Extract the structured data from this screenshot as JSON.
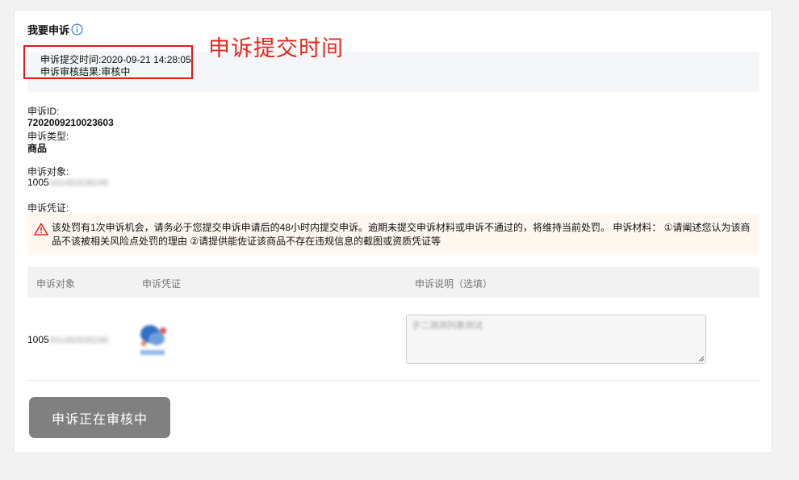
{
  "page": {
    "title": "我要申诉"
  },
  "annotation": {
    "label": "申诉提交时间"
  },
  "status": {
    "submit_time_label": "申诉提交时间:",
    "submit_time_value": "2020-09-21 14:28:05",
    "result_label": "申诉审核结果:",
    "result_value": "审核中"
  },
  "details": {
    "id_label": "申诉ID:",
    "id_value": "7202009210023603",
    "type_label": "申诉类型:",
    "type_value": "商品",
    "target_label": "申诉对象:",
    "target_value_prefix": "1005",
    "target_value_blurred": "001482638248",
    "evidence_label": "申诉凭证:"
  },
  "warning": {
    "text": "该处罚有1次申诉机会，请务必于您提交申诉申请后的48小时内提交申诉。逾期未提交申诉材料或申诉不通过的，将维持当前处罚。 申诉材料： ①请阐述您认为该商品不该被相关风险点处罚的理由 ②请提供能佐证该商品不存在违规信息的截图或资质凭证等"
  },
  "table": {
    "headers": [
      "申诉对象",
      "申诉凭证",
      "申诉说明（选填）"
    ],
    "row": {
      "target_prefix": "1005",
      "target_blurred": "001482638248",
      "description": "子二测测列表测试"
    }
  },
  "actions": {
    "submit_label": "申诉正在审核中"
  },
  "colors": {
    "annotation_red": "#e8261c",
    "button_gray": "#808080",
    "info_blue": "#3b7de0",
    "warning_red": "#e0342a"
  }
}
